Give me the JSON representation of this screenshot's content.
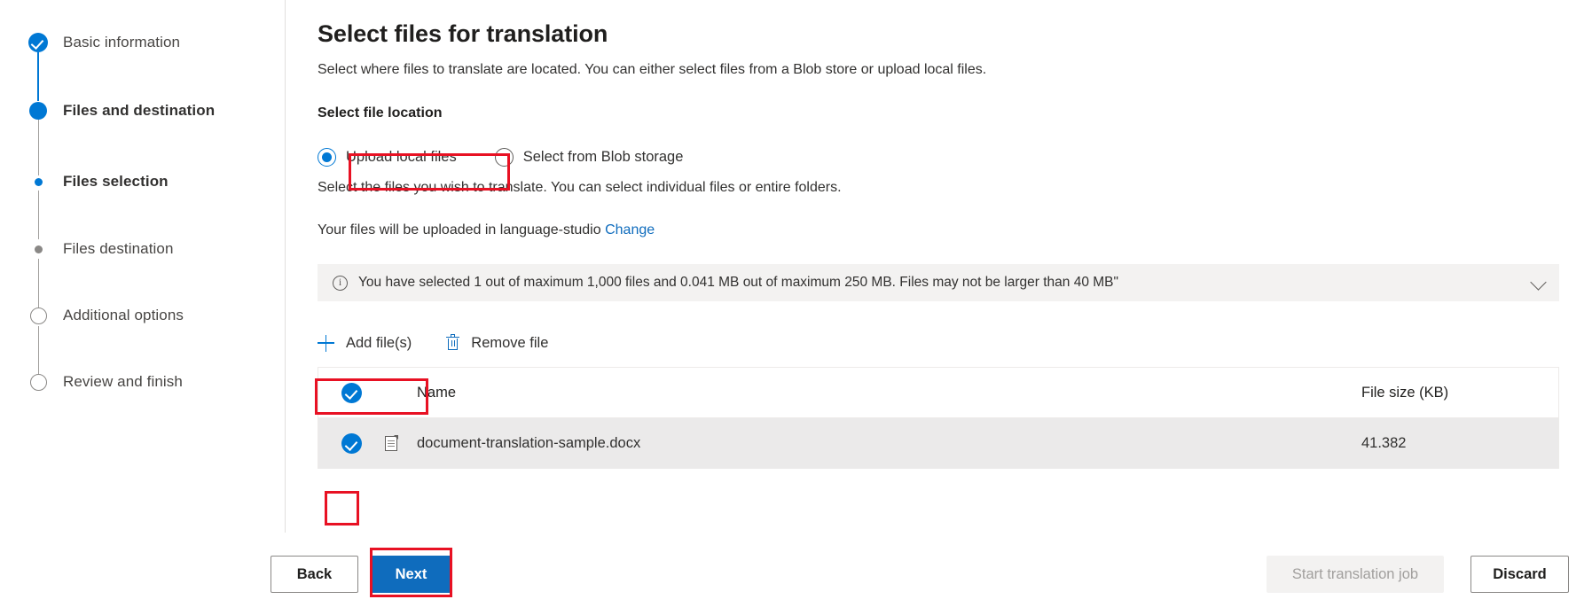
{
  "sidebar": {
    "steps": [
      {
        "label": "Basic information",
        "state": "done",
        "marker": "check-circle-icon"
      },
      {
        "label": "Files and destination",
        "state": "current",
        "marker": "filled-circle-icon"
      },
      {
        "label": "Files selection",
        "state": "sub-current",
        "marker": "small-blue-dot-icon"
      },
      {
        "label": "Files destination",
        "state": "sub-pending",
        "marker": "small-grey-dot-icon"
      },
      {
        "label": "Additional options",
        "state": "pending",
        "marker": "empty-circle-icon"
      },
      {
        "label": "Review and finish",
        "state": "pending",
        "marker": "empty-circle-icon"
      }
    ]
  },
  "main": {
    "title": "Select files for translation",
    "description": "Select where files to translate are located. You can either select files from a Blob store or upload local files.",
    "file_location": {
      "label": "Select file location",
      "options": [
        {
          "label": "Upload local files",
          "selected": true
        },
        {
          "label": "Select from Blob storage",
          "selected": false
        }
      ]
    },
    "sub_description": "Select the files you wish to translate. You can select individual files or entire folders.",
    "upload_target": {
      "text": "Your files will be uploaded in language-studio",
      "change_link": "Change"
    },
    "info_bar": {
      "message": "You have selected 1 out of maximum 1,000 files and 0.041 MB out of maximum 250 MB. Files may not be larger than 40 MB\"",
      "expand_icon": "chevron-down-icon"
    },
    "command_bar": {
      "add_files": "Add file(s)",
      "remove_file": "Remove file"
    },
    "table": {
      "columns": [
        "Name",
        "File size (KB)"
      ],
      "select_all_checked": true,
      "rows": [
        {
          "name": "document-translation-sample.docx",
          "size": "41.382",
          "selected": true
        }
      ]
    }
  },
  "footer": {
    "back": "Back",
    "next": "Next",
    "start_translation_job": "Start translation job",
    "discard": "Discard"
  },
  "colors": {
    "accent": "#0078d4",
    "primary_button": "#0f6cbd",
    "link": "#0f6cbd",
    "annotation": "#e81123",
    "info_bar_bg": "#f3f2f1",
    "selected_row_bg": "#ebeaea"
  }
}
